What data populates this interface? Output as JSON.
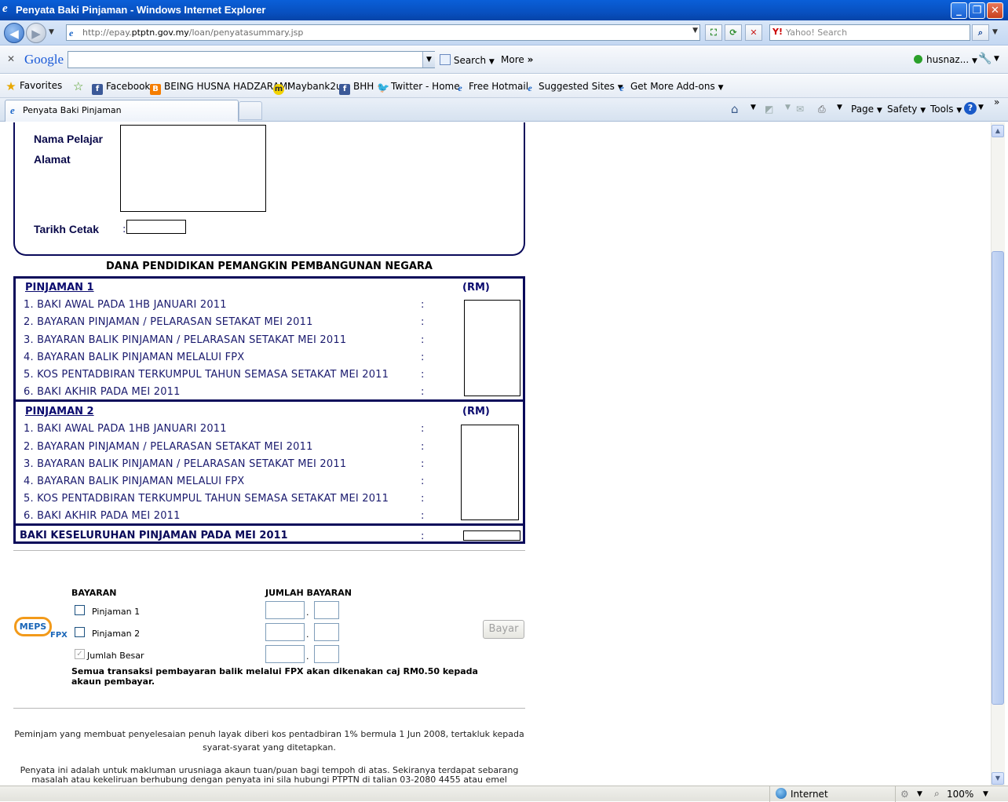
{
  "window": {
    "title": "Penyata Baki Pinjaman - Windows Internet Explorer"
  },
  "address": {
    "url_prefix": "http://epay.",
    "url_host": "ptptn.gov.my",
    "url_path": "/loan/penyatasummary.jsp",
    "search_placeholder": "Yahoo! Search"
  },
  "google_toolbar": {
    "logo": "Google",
    "search_label": "Search",
    "more_label": "More",
    "user": "husnaz..."
  },
  "favorites": {
    "favorites_label": "Favorites",
    "items": [
      {
        "label": "Facebook"
      },
      {
        "label": "BEING HUSNA HADZARAMI"
      },
      {
        "label": "Maybank2u"
      },
      {
        "label": "BHH"
      },
      {
        "label": "Twitter - Home"
      },
      {
        "label": "Free Hotmail"
      },
      {
        "label": "Suggested Sites"
      },
      {
        "label": "Get More Add-ons"
      }
    ]
  },
  "tabs": {
    "active": "Penyata Baki Pinjaman"
  },
  "commands": {
    "page": "Page",
    "safety": "Safety",
    "tools": "Tools"
  },
  "form": {
    "nama_pelajar": "Nama Pelajar",
    "alamat": "Alamat",
    "tarikh_cetak": "Tarikh Cetak",
    "colon": ":",
    "banner": "DANA PENDIDIKAN PEMANGKIN PEMBANGUNAN NEGARA"
  },
  "loans": [
    {
      "heading": "PINJAMAN 1",
      "rm": "(RM)",
      "rows": [
        "1. BAKI AWAL PADA 1HB JANUARI 2011",
        "2. BAYARAN PINJAMAN / PELARASAN SETAKAT MEI 2011",
        "3. BAYARAN BALIK PINJAMAN / PELARASAN SETAKAT MEI 2011",
        "4. BAYARAN BALIK PINJAMAN MELALUI FPX",
        "5. KOS PENTADBIRAN TERKUMPUL TAHUN SEMASA SETAKAT MEI 2011",
        "6. BAKI AKHIR PADA MEI 2011"
      ]
    },
    {
      "heading": "PINJAMAN 2",
      "rm": "(RM)",
      "rows": [
        "1. BAKI AWAL PADA 1HB JANUARI 2011",
        "2. BAYARAN PINJAMAN / PELARASAN SETAKAT MEI 2011",
        "3. BAYARAN BALIK PINJAMAN / PELARASAN SETAKAT MEI 2011",
        "4. BAYARAN BALIK PINJAMAN MELALUI FPX",
        "5. KOS PENTADBIRAN TERKUMPUL TAHUN SEMASA SETAKAT MEI 2011",
        "6. BAKI AKHIR PADA MEI 2011"
      ]
    }
  ],
  "total_label": "BAKI KESELURUHAN PINJAMAN PADA MEI 2011",
  "payment": {
    "logo_meps": "MEPS",
    "logo_fpx": "FPX",
    "col_bayaran": "BAYARAN",
    "col_jumlah": "JUMLAH BAYARAN",
    "opt1": "Pinjaman 1",
    "opt2": "Pinjaman 2",
    "opt3": "Jumlah Besar",
    "dot": ".",
    "pay_button": "Bayar",
    "note": "Semua transaksi pembayaran balik melalui FPX akan dikenakan caj RM0.50 kepada akaun pembayar."
  },
  "footer": {
    "p1": "Peminjam yang membuat penyelesaian penuh layak diberi kos pentadbiran 1% bermula 1 Jun 2008, tertakluk kepada syarat-syarat yang ditetapkan.",
    "p2": "Penyata ini adalah untuk makluman urusniaga akaun tuan/puan bagi tempoh di atas. Sekiranya terdapat sebarang masalah atau kekeliruan berhubung dengan penyata ini sila hubungi PTPTN di talian 03-2080 4455 atau emel"
  },
  "status": {
    "zone": "Internet",
    "zoom": "100%"
  }
}
